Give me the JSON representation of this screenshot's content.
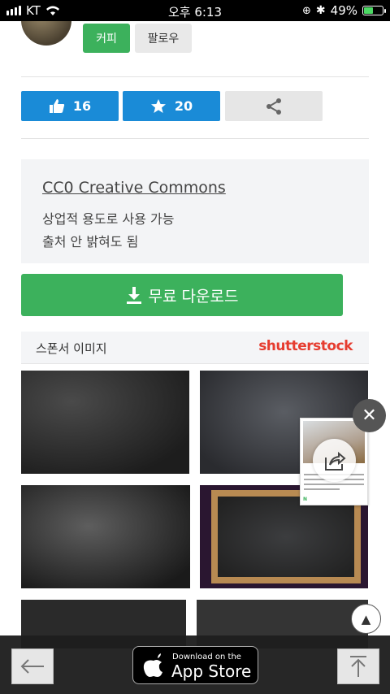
{
  "status_bar": {
    "carrier": "KT",
    "time": "오후 6:13",
    "battery": "49%",
    "battery_level": 0.49
  },
  "profile": {
    "copy_label": "커피",
    "follow_label": "팔로우"
  },
  "actions": {
    "likes": "16",
    "favorites": "20"
  },
  "license": {
    "title": "CC0 Creative Commons",
    "line1": "상업적 용도로 사용 가능",
    "line2": "출처 안 밝혀도 됨"
  },
  "download": {
    "label": "무료 다운로드"
  },
  "sponsor": {
    "label": "스폰서 이미지",
    "brand": "shutterstock"
  },
  "bottom_bar": {
    "appstore_small": "Download on the",
    "appstore_big": "App Store"
  },
  "colors": {
    "green": "#3cb15c",
    "blue": "#1a8bd7",
    "shutterstock_red": "#e63c2f"
  }
}
